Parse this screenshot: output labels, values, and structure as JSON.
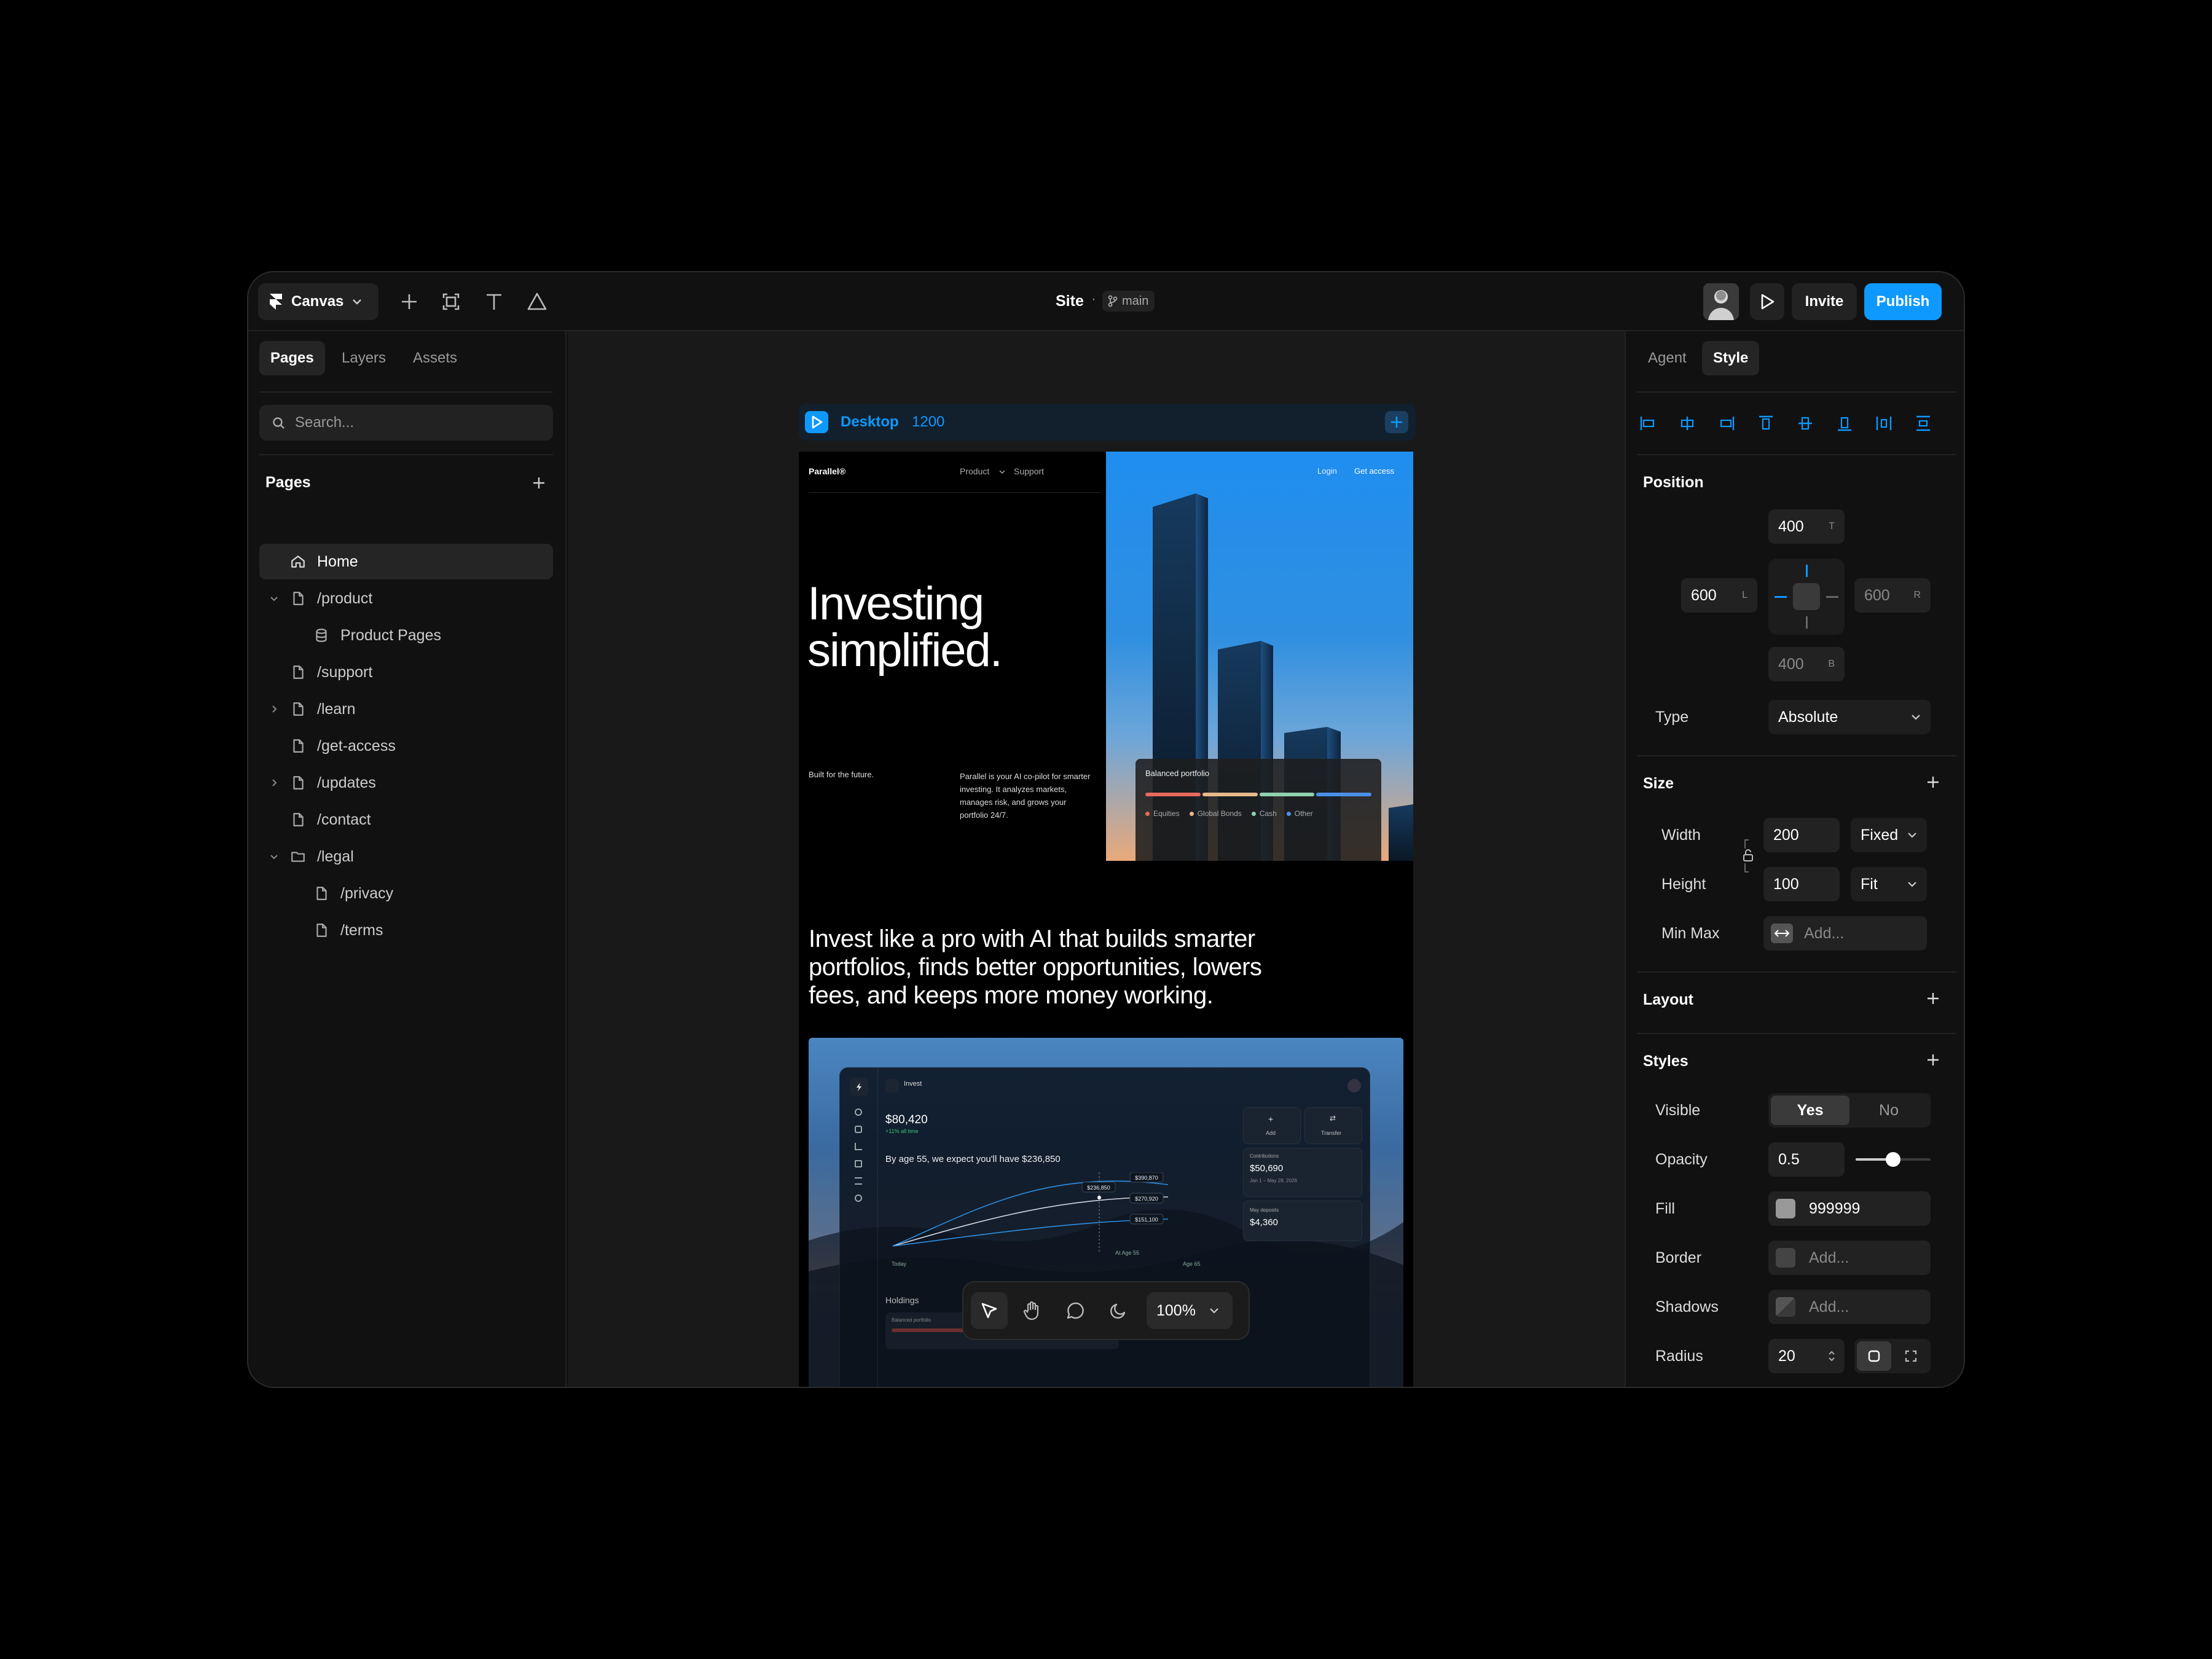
{
  "topbar": {
    "app_label": "Canvas",
    "site_name": "Site",
    "branch": "main",
    "invite_label": "Invite",
    "publish_label": "Publish",
    "tools": [
      "plus-icon",
      "frame-icon",
      "text-icon",
      "shape-icon"
    ]
  },
  "left_panel": {
    "tabs": [
      {
        "label": "Pages"
      },
      {
        "label": "Layers"
      },
      {
        "label": "Assets"
      }
    ],
    "search_placeholder": "Search...",
    "pages_heading": "Pages",
    "pages": [
      {
        "label": "Home",
        "icon": "home-icon",
        "selected": true
      },
      {
        "label": "/product",
        "icon": "page-icon",
        "expanded": true
      },
      {
        "label": "Product Pages",
        "icon": "database-icon"
      },
      {
        "label": "/support",
        "icon": "page-icon"
      },
      {
        "label": "/learn",
        "icon": "page-icon",
        "collapsed": true
      },
      {
        "label": "/get-access",
        "icon": "page-icon"
      },
      {
        "label": "/updates",
        "icon": "page-icon",
        "collapsed": true
      },
      {
        "label": "/contact",
        "icon": "page-icon"
      },
      {
        "label": "/legal",
        "icon": "folder-icon",
        "expanded": true
      },
      {
        "label": "/privacy",
        "icon": "page-icon"
      },
      {
        "label": "/terms",
        "icon": "page-icon"
      }
    ]
  },
  "canvas": {
    "frame_name": "Desktop",
    "frame_width": "1200",
    "zoom": "100%",
    "bottom_tools": [
      "pointer-icon",
      "hand-icon",
      "comment-icon",
      "moon-icon"
    ]
  },
  "site": {
    "brand": "Parallel®",
    "nav_product": "Product",
    "nav_support": "Support",
    "login": "Login",
    "get_access": "Get access",
    "hero_line1": "Investing",
    "hero_line2": "simplified.",
    "tagline": "Built for the future.",
    "description": "Parallel is your AI co-pilot for smarter investing. It analyzes markets, manages risk, and grows your portfolio 24/7.",
    "portfolio_title": "Balanced portfolio",
    "portfolio_legend": [
      "Equities",
      "Global Bonds",
      "Cash",
      "Other"
    ],
    "portfolio_colors": [
      "#e8685c",
      "#e8b98a",
      "#8fd1b0",
      "#4a8fe8"
    ],
    "statement_line1": "Invest like a pro with AI that builds smarter",
    "statement_line2": "portfolios, finds better opportunities, lowers",
    "statement_line3": "fees, and keeps more money working."
  },
  "dashboard": {
    "menu": "Invest",
    "balance": "$80,420",
    "change": "+11% all time",
    "projection": "By age 55, we expect you'll have $236,850",
    "marker_value": "$236,850",
    "high": "$390,870",
    "mid": "$270,920",
    "low": "$151,100",
    "x_start": "Today",
    "x_marker": "At Age 55",
    "x_end": "Age 65",
    "add": "Add",
    "transfer": "Transfer",
    "contributions_label": "Contributions",
    "contributions_value": "$50,690",
    "contributions_range": "Jan 1 – May 28, 2026",
    "deposits_label": "May deposits",
    "deposits_value": "$4,360",
    "holdings": "Holdings",
    "holdings_sub": "Balanced portfolio"
  },
  "right_panel": {
    "tabs": [
      {
        "label": "Agent"
      },
      {
        "label": "Style"
      }
    ],
    "position_heading": "Position",
    "pos_top": "400",
    "pos_left": "600",
    "pos_right": "600",
    "pos_bottom": "400",
    "pos_top_suffix": "T",
    "pos_left_suffix": "L",
    "pos_right_suffix": "R",
    "pos_bottom_suffix": "B",
    "type_label": "Type",
    "type_value": "Absolute",
    "size_heading": "Size",
    "width_label": "Width",
    "width_value": "200",
    "width_mode": "Fixed",
    "height_label": "Height",
    "height_value": "100",
    "height_mode": "Fit",
    "minmax_label": "Min Max",
    "minmax_placeholder": "Add...",
    "layout_heading": "Layout",
    "styles_heading": "Styles",
    "visible_label": "Visible",
    "visible_yes": "Yes",
    "visible_no": "No",
    "opacity_label": "Opacity",
    "opacity_value": "0.5",
    "fill_label": "Fill",
    "fill_value": "999999",
    "fill_color": "#999999",
    "border_label": "Border",
    "border_placeholder": "Add...",
    "shadows_label": "Shadows",
    "shadows_placeholder": "Add...",
    "radius_label": "Radius",
    "radius_value": "20"
  },
  "colors": {
    "accent": "#0d99ff",
    "background": "#111111",
    "canvas": "#191919"
  }
}
